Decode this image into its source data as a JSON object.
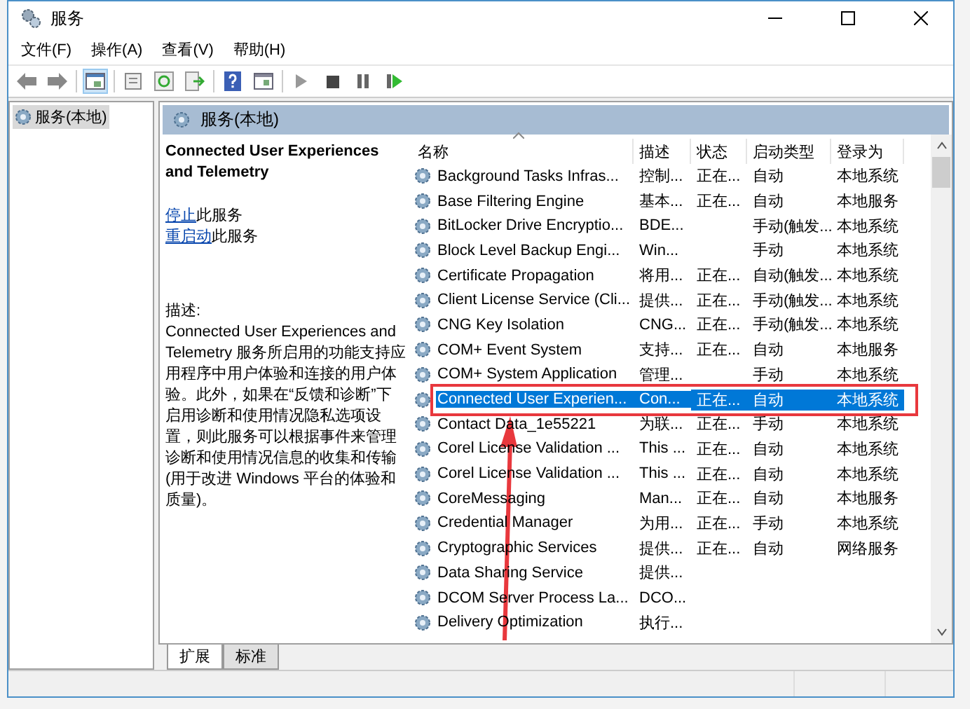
{
  "window": {
    "title": "服务"
  },
  "menu": [
    {
      "label": "文件(F)"
    },
    {
      "label": "操作(A)"
    },
    {
      "label": "查看(V)"
    },
    {
      "label": "帮助(H)"
    }
  ],
  "tree": {
    "items": [
      {
        "label": "服务(本地)",
        "selected": true
      }
    ]
  },
  "pane": {
    "title": "服务(本地)"
  },
  "details": {
    "title": "Connected User Experiences and Telemetry",
    "actions": [
      {
        "link": "停止",
        "rest": "此服务"
      },
      {
        "link": "重启动",
        "rest": "此服务"
      }
    ],
    "description_label": "描述:",
    "description": "Connected User Experiences and Telemetry 服务所启用的功能支持应用程序中用户体验和连接的用户体验。此外，如果在“反馈和诊断”下启用诊断和使用情况隐私选项设置，则此服务可以根据事件来管理诊断和使用情况信息的收集和传输(用于改进 Windows 平台的体验和质量)。"
  },
  "table": {
    "columns": [
      "名称",
      "描述",
      "状态",
      "启动类型",
      "登录为"
    ],
    "rows": [
      {
        "name": "Background Tasks Infras...",
        "desc": "控制...",
        "status": "正在...",
        "startup": "自动",
        "logon": "本地系统",
        "selected": false
      },
      {
        "name": "Base Filtering Engine",
        "desc": "基本...",
        "status": "正在...",
        "startup": "自动",
        "logon": "本地服务",
        "selected": false
      },
      {
        "name": "BitLocker Drive Encryptio...",
        "desc": "BDE...",
        "status": "",
        "startup": "手动(触发...",
        "logon": "本地系统",
        "selected": false
      },
      {
        "name": "Block Level Backup Engi...",
        "desc": "Win...",
        "status": "",
        "startup": "手动",
        "logon": "本地系统",
        "selected": false
      },
      {
        "name": "Certificate Propagation",
        "desc": "将用...",
        "status": "正在...",
        "startup": "自动(触发...",
        "logon": "本地系统",
        "selected": false
      },
      {
        "name": "Client License Service (Cli...",
        "desc": "提供...",
        "status": "正在...",
        "startup": "手动(触发...",
        "logon": "本地系统",
        "selected": false
      },
      {
        "name": "CNG Key Isolation",
        "desc": "CNG...",
        "status": "正在...",
        "startup": "手动(触发...",
        "logon": "本地系统",
        "selected": false
      },
      {
        "name": "COM+ Event System",
        "desc": "支持...",
        "status": "正在...",
        "startup": "自动",
        "logon": "本地服务",
        "selected": false
      },
      {
        "name": "COM+ System Application",
        "desc": "管理...",
        "status": "",
        "startup": "手动",
        "logon": "本地系统",
        "selected": false
      },
      {
        "name": "Connected User Experien...",
        "desc": "Con...",
        "status": "正在...",
        "startup": "自动",
        "logon": "本地系统",
        "selected": true
      },
      {
        "name": "Contact Data_1e55221",
        "desc": "为联...",
        "status": "正在...",
        "startup": "手动",
        "logon": "本地系统",
        "selected": false
      },
      {
        "name": "Corel License Validation ...",
        "desc": "This ...",
        "status": "正在...",
        "startup": "自动",
        "logon": "本地系统",
        "selected": false
      },
      {
        "name": "Corel License Validation ...",
        "desc": "This ...",
        "status": "正在...",
        "startup": "自动",
        "logon": "本地系统",
        "selected": false
      },
      {
        "name": "CoreMessaging",
        "desc": "Man...",
        "status": "正在...",
        "startup": "自动",
        "logon": "本地服务",
        "selected": false
      },
      {
        "name": "Credential Manager",
        "desc": "为用...",
        "status": "正在...",
        "startup": "手动",
        "logon": "本地系统",
        "selected": false
      },
      {
        "name": "Cryptographic Services",
        "desc": "提供...",
        "status": "正在...",
        "startup": "自动",
        "logon": "网络服务",
        "selected": false
      },
      {
        "name": "Data Sharing Service",
        "desc": "提供...",
        "status": "",
        "startup": "",
        "logon": "",
        "selected": false
      },
      {
        "name": "DCOM Server Process La...",
        "desc": "DCO...",
        "status": "",
        "startup": "",
        "logon": "",
        "selected": false
      },
      {
        "name": "Delivery Optimization",
        "desc": "执行...",
        "status": "",
        "startup": "",
        "logon": "",
        "selected": false
      }
    ]
  },
  "tabs": [
    {
      "label": "扩展",
      "selected": true
    },
    {
      "label": "标准",
      "selected": false
    }
  ]
}
